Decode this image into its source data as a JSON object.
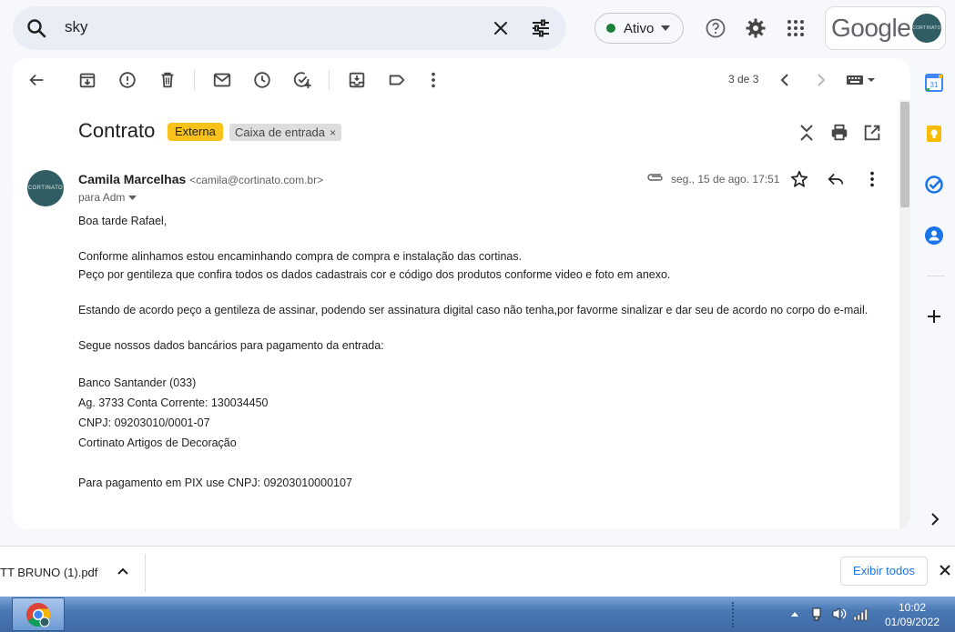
{
  "search": {
    "query": "sky"
  },
  "status": {
    "label": "Ativo",
    "color": "#188038"
  },
  "account": {
    "brand": "Google",
    "avatar_text": "CORTINATO"
  },
  "toolbar": {
    "pager": "3 de 3"
  },
  "email": {
    "subject": "Contrato",
    "label_external": "Externa",
    "label_inbox": "Caixa de entrada",
    "label_inbox_remove": "×",
    "sender_name": "Camila Marcelhas",
    "sender_email": "<camila@cortinato.com.br>",
    "to": "para Adm",
    "date": "seg., 15 de ago. 17:51",
    "avatar_text": "CORTINATO",
    "body": {
      "greeting": "Boa tarde Rafael,",
      "p1": "Conforme alinhamos estou encaminhando compra de compra e instalação das cortinas.",
      "p2": "Peço por gentileza que confira todos os dados cadastrais cor e código dos produtos conforme video e foto em anexo.",
      "p3": "Estando de acordo peço a gentileza de assinar, podendo ser assinatura digital caso não tenha,por favorme sinalizar e dar seu de acordo no corpo do e-mail.",
      "p4": "Segue nossos dados bancários para pagamento da entrada:",
      "bank1": "Banco Santander (033)",
      "bank2": "Ag. 3733 Conta Corrente: 130034450",
      "bank3": "CNPJ: 09203010/0001-07",
      "bank4": "Cortinato Artigos de Decoração",
      "pix": "Para pagamento em PIX use CNPJ: 09203010000107"
    }
  },
  "downloads": {
    "file": "TT BRUNO (1).pdf",
    "show_all": "Exibir todos"
  },
  "taskbar": {
    "time": "10:02",
    "date": "01/09/2022"
  },
  "colors": {
    "accent": "#1a73e8",
    "label_external": "#f9c21b",
    "avatar": "#2f5d63"
  }
}
